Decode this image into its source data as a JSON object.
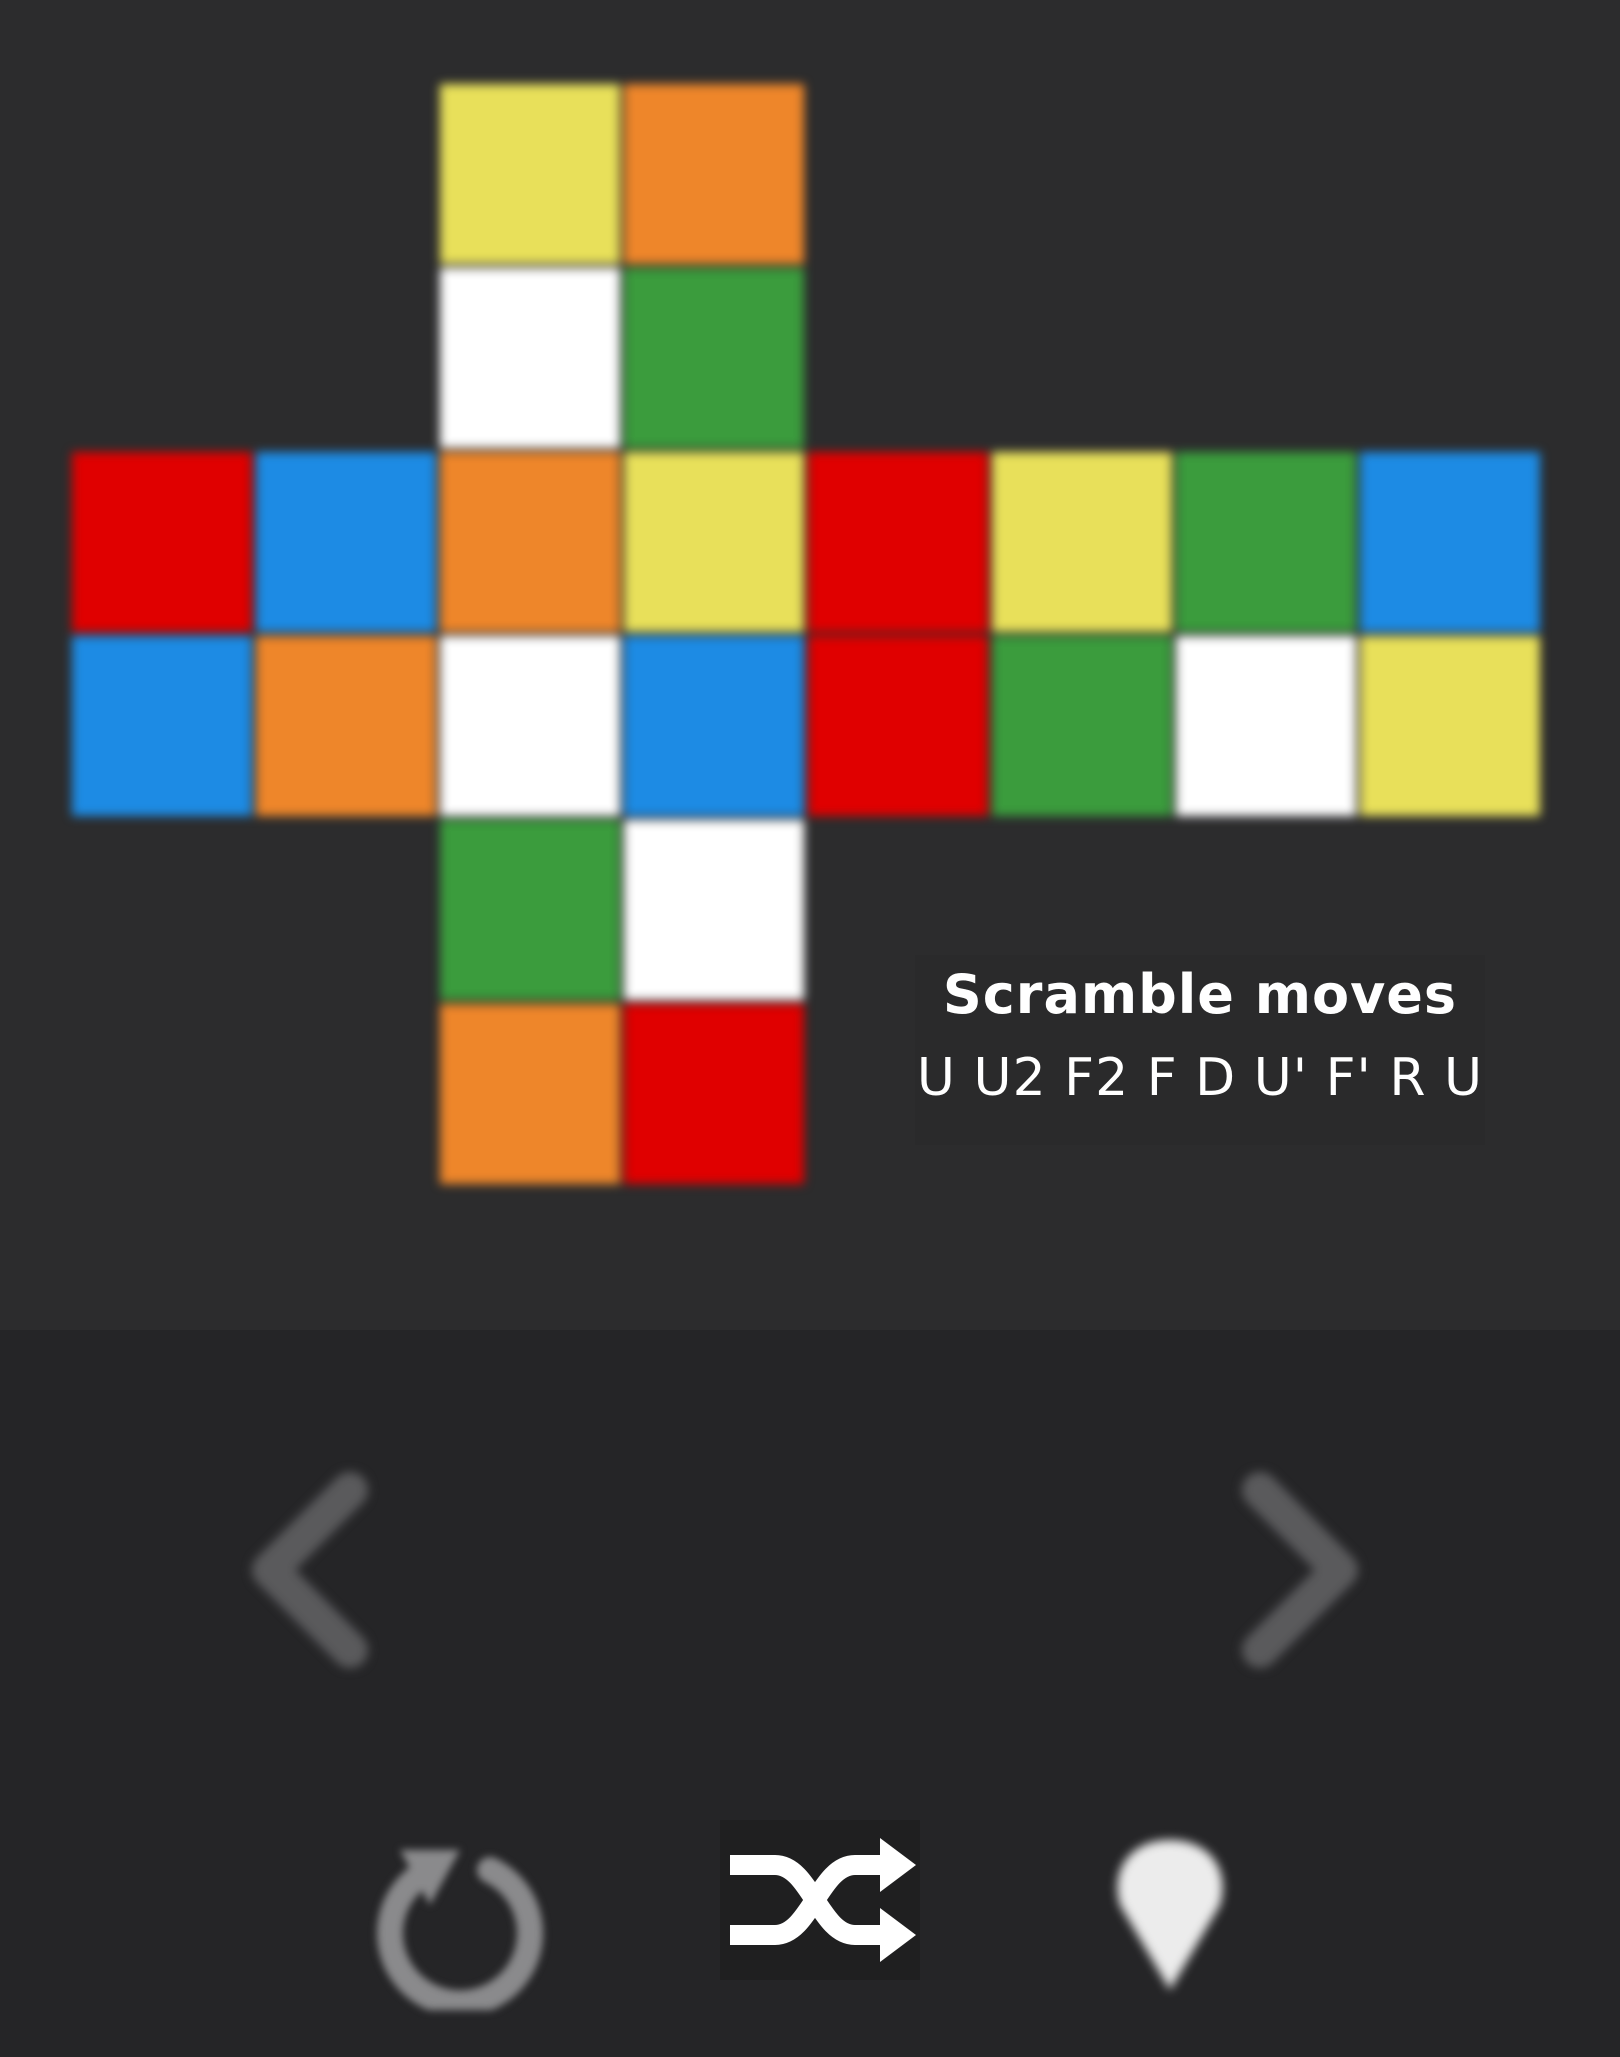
{
  "colors": {
    "yellow": "#e8e05a",
    "orange": "#ee862a",
    "white": "#ffffff",
    "green": "#3b9c3d",
    "red": "#e00000",
    "blue": "#1d8be4",
    "background_top": "#2c2c2d",
    "background_bottom": "#252527"
  },
  "cube_net": {
    "up": [
      [
        "yellow",
        "orange"
      ],
      [
        "white",
        "green"
      ]
    ],
    "left": [
      [
        "red",
        "blue"
      ],
      [
        "blue",
        "orange"
      ]
    ],
    "front": [
      [
        "orange",
        "yellow"
      ],
      [
        "white",
        "blue"
      ]
    ],
    "right": [
      [
        "red",
        "yellow"
      ],
      [
        "red",
        "green"
      ]
    ],
    "back": [
      [
        "green",
        "blue"
      ],
      [
        "white",
        "yellow"
      ]
    ],
    "down": [
      [
        "green",
        "white"
      ],
      [
        "orange",
        "red"
      ]
    ]
  },
  "scramble": {
    "title": "Scramble moves",
    "moves": "U U2 F2 F D U' F' R U"
  },
  "navigation": {
    "prev_icon": "chevron-left-icon",
    "next_icon": "chevron-right-icon"
  },
  "toolbar": {
    "reset_icon": "reset-icon",
    "shuffle_icon": "shuffle-icon",
    "hint_icon": "lightbulb-icon"
  }
}
